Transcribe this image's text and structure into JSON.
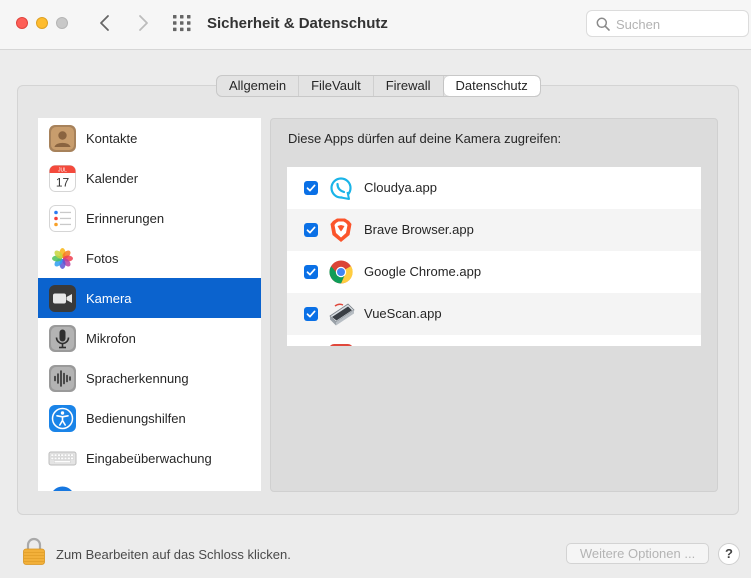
{
  "window": {
    "title": "Sicherheit & Datenschutz",
    "search_placeholder": "Suchen"
  },
  "tabs": [
    {
      "label": "Allgemein",
      "active": false
    },
    {
      "label": "FileVault",
      "active": false
    },
    {
      "label": "Firewall",
      "active": false
    },
    {
      "label": "Datenschutz",
      "active": true
    }
  ],
  "sidebar": {
    "selected": "Kamera",
    "items": [
      {
        "label": "Kontakte",
        "icon": "contacts-icon"
      },
      {
        "label": "Kalender",
        "icon": "calendar-icon",
        "icon_month": "JUL",
        "icon_day": "17"
      },
      {
        "label": "Erinnerungen",
        "icon": "reminders-icon"
      },
      {
        "label": "Fotos",
        "icon": "photos-icon"
      },
      {
        "label": "Kamera",
        "icon": "camera-icon"
      },
      {
        "label": "Mikrofon",
        "icon": "microphone-icon"
      },
      {
        "label": "Spracherkennung",
        "icon": "speech-recognition-icon"
      },
      {
        "label": "Bedienungshilfen",
        "icon": "accessibility-icon"
      },
      {
        "label": "Eingabeüberwachung",
        "icon": "keyboard-icon"
      }
    ]
  },
  "camera_pane": {
    "title": "Diese Apps dürfen auf deine Kamera zugreifen:",
    "apps": [
      {
        "name": "Cloudya.app",
        "checked": true,
        "icon": "cloudya-icon"
      },
      {
        "name": "Brave Browser.app",
        "checked": true,
        "icon": "brave-icon"
      },
      {
        "name": "Google Chrome.app",
        "checked": true,
        "icon": "chrome-icon"
      },
      {
        "name": "VueScan.app",
        "checked": true,
        "icon": "vuescan-icon"
      }
    ]
  },
  "footer": {
    "lock_text": "Zum Bearbeiten auf das Schloss klicken.",
    "advanced_button": "Weitere Optionen ...",
    "help_button": "?"
  },
  "colors": {
    "accent": "#0b63ce",
    "checkbox": "#0a70e6"
  }
}
